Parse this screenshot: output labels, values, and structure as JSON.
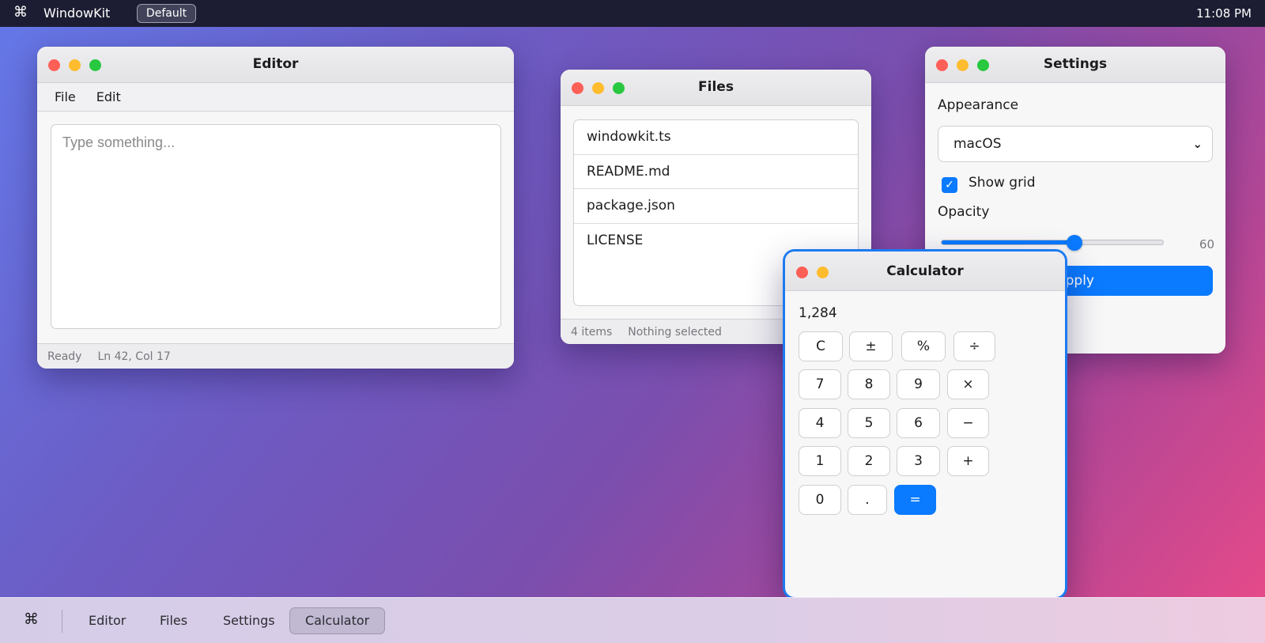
{
  "menubar": {
    "command_glyph": "⌘",
    "app_name": "WindowKit",
    "profile_label": "Default",
    "clock": "11:08 PM"
  },
  "editor": {
    "title": "Editor",
    "menu": [
      "File",
      "Edit"
    ],
    "placeholder": "Type something...",
    "value": "",
    "status": "Ready",
    "cursor": "Ln 42, Col 17"
  },
  "files": {
    "title": "Files",
    "items": [
      "windowkit.ts",
      "README.md",
      "package.json",
      "LICENSE"
    ],
    "item_count": "4 items",
    "selection": "Nothing selected"
  },
  "settings": {
    "title": "Settings",
    "appearance_label": "Appearance",
    "appearance_value": "macOS",
    "show_grid_label": "Show grid",
    "show_grid_checked": true,
    "opacity_label": "Opacity",
    "opacity_value": "60",
    "opacity_fraction": 0.6,
    "apply_label": "Apply"
  },
  "calculator": {
    "title": "Calculator",
    "display": "1,284",
    "keys": {
      "clear": "C",
      "sign": "±",
      "percent": "%",
      "divide": "÷",
      "seven": "7",
      "eight": "8",
      "nine": "9",
      "multiply": "×",
      "four": "4",
      "five": "5",
      "six": "6",
      "minus": "−",
      "one": "1",
      "two": "2",
      "three": "3",
      "plus": "+",
      "zero": "0",
      "dot": ".",
      "equals": "="
    }
  },
  "dock": {
    "command_glyph": "⌘",
    "items": [
      "Editor",
      "Files",
      "Settings",
      "Calculator"
    ],
    "active": "Calculator"
  },
  "colors": {
    "accent": "#0a7aff",
    "close": "#fe5f57",
    "minimize": "#febc2e",
    "zoom": "#28c840",
    "menubar": "#1c1d32"
  }
}
